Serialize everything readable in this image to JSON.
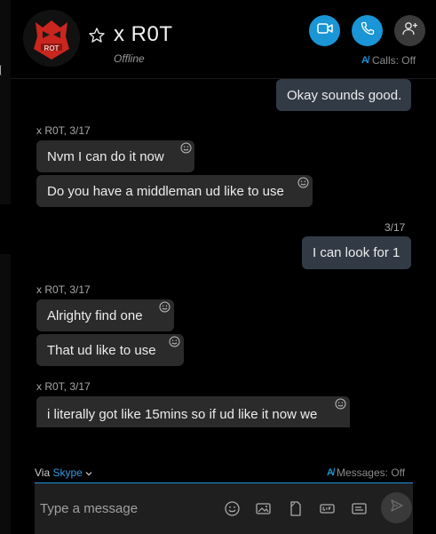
{
  "header": {
    "contact_name": "x R0T",
    "status": "Offline",
    "calls_label": "Calls: Off"
  },
  "messages": [
    {
      "id": "m1",
      "direction": "out",
      "text": "Okay sounds good."
    },
    {
      "id": "h1",
      "type": "sender",
      "label": "x R0T, 3/17"
    },
    {
      "id": "m2",
      "direction": "in",
      "text": "Nvm I can do it now"
    },
    {
      "id": "m3",
      "direction": "in",
      "text": "Do you have a middleman ud like to use"
    },
    {
      "id": "h2",
      "type": "date",
      "label": "3/17"
    },
    {
      "id": "m4",
      "direction": "out",
      "text": "I can look for 1"
    },
    {
      "id": "h3",
      "type": "sender",
      "label": "x R0T, 3/17"
    },
    {
      "id": "m5",
      "direction": "in",
      "text": "Alrighty find one"
    },
    {
      "id": "m6",
      "direction": "in",
      "text": "That ud like to use"
    },
    {
      "id": "h4",
      "type": "sender",
      "label": "x R0T, 3/17"
    },
    {
      "id": "m7",
      "direction": "in",
      "text": "i literally got like 15mins so if ud like it now we"
    }
  ],
  "footer": {
    "via_label": "Via",
    "via_link": "Skype",
    "messages_label": "Messages: Off",
    "placeholder": "Type a message"
  },
  "colors": {
    "accent": "#1a95d6",
    "background": "#000000",
    "incoming_bubble": "#2b2b2b",
    "outgoing_bubble": "#313a45"
  },
  "icons": [
    "star-icon",
    "video-call-icon",
    "phone-icon",
    "add-person-icon",
    "translate-icon",
    "emoji-icon",
    "image-icon",
    "file-icon",
    "gif-icon",
    "contact-card-icon",
    "send-icon",
    "chevron-down-icon",
    "reaction-icon"
  ]
}
